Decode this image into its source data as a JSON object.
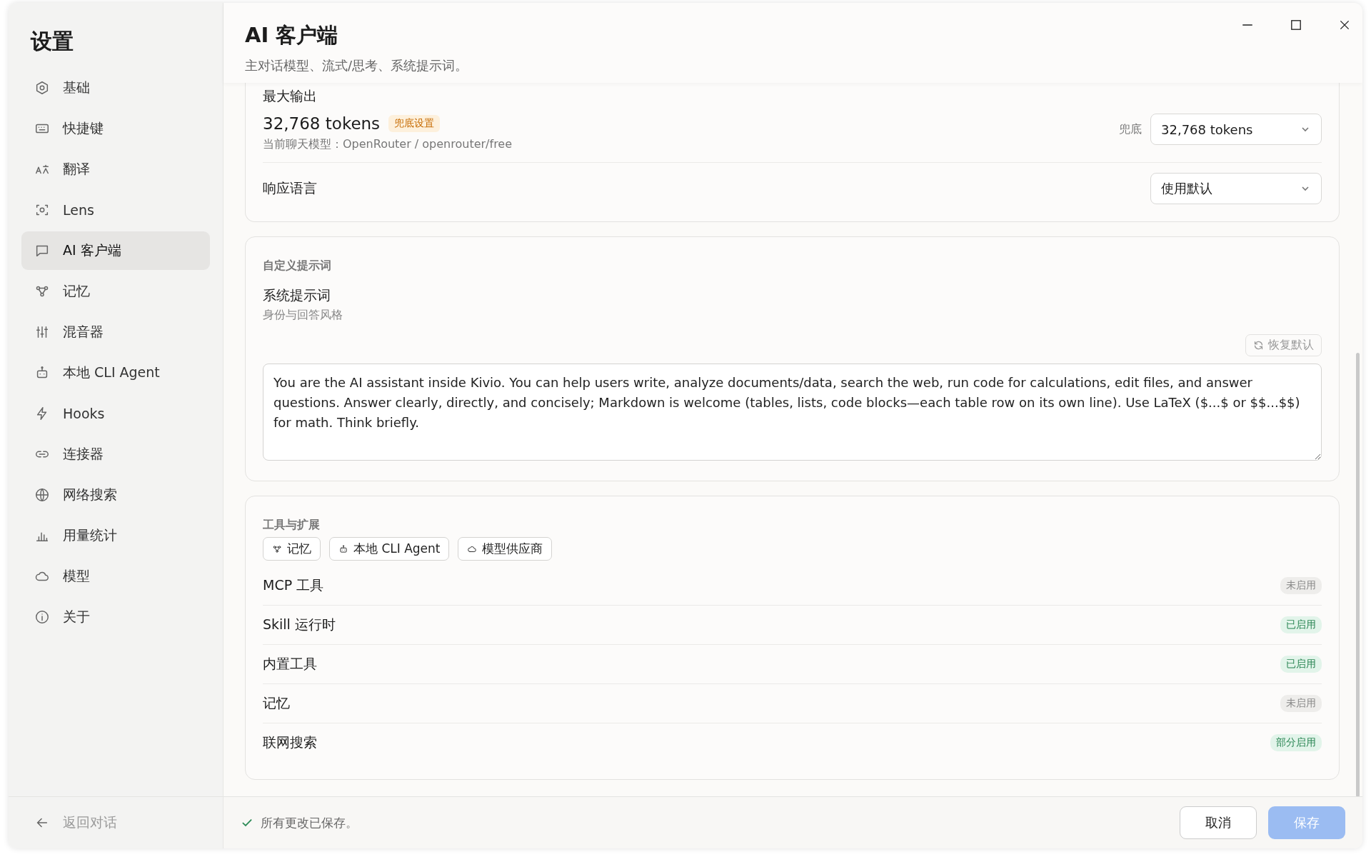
{
  "sidebar": {
    "title": "设置",
    "items": [
      {
        "label": "基础",
        "selected": false
      },
      {
        "label": "快捷键",
        "selected": false
      },
      {
        "label": "翻译",
        "selected": false
      },
      {
        "label": "Lens",
        "selected": false
      },
      {
        "label": "AI 客户端",
        "selected": true
      },
      {
        "label": "记忆",
        "selected": false
      },
      {
        "label": "混音器",
        "selected": false
      },
      {
        "label": "本地 CLI Agent",
        "selected": false
      },
      {
        "label": "Hooks",
        "selected": false
      },
      {
        "label": "连接器",
        "selected": false
      },
      {
        "label": "网络搜索",
        "selected": false
      },
      {
        "label": "用量统计",
        "selected": false
      },
      {
        "label": "模型",
        "selected": false
      },
      {
        "label": "关于",
        "selected": false
      }
    ],
    "back": "返回对话"
  },
  "header": {
    "title": "AI 客户端",
    "subtitle": "主对话模型、流式/思考、系统提示词。"
  },
  "output_card": {
    "label": "最大输出",
    "value": "32,768 tokens",
    "badge": "兜底设置",
    "model_note": "当前聊天模型：OpenRouter / openrouter/free",
    "select_label": "兜底",
    "select_value": "32,768 tokens",
    "language_label": "响应语言",
    "language_value": "使用默认"
  },
  "prompt_card": {
    "section": "自定义提示词",
    "label": "系统提示词",
    "hint": "身份与回答风格",
    "reset": "恢复默认",
    "value": "You are the AI assistant inside Kivio. You can help users write, analyze documents/data, search the web, run code for calculations, edit files, and answer questions. Answer clearly, directly, and concisely; Markdown is welcome (tables, lists, code blocks—each table row on its own line). Use LaTeX ($...$ or $$...$$) for math. Think briefly."
  },
  "tools_card": {
    "section": "工具与扩展",
    "chips": [
      "记忆",
      "本地 CLI Agent",
      "模型供应商"
    ],
    "rows": [
      {
        "label": "MCP 工具",
        "enabled": false,
        "badge": "未启用"
      },
      {
        "label": "Skill 运行时",
        "enabled": true,
        "badge": "已启用"
      },
      {
        "label": "内置工具",
        "enabled": true,
        "badge": "已启用"
      },
      {
        "label": "记忆",
        "enabled": false,
        "badge": "未启用"
      },
      {
        "label": "联网搜索",
        "enabled": true,
        "badge": "部分启用"
      }
    ]
  },
  "footer": {
    "status": "所有更改已保存。",
    "cancel": "取消",
    "save": "保存",
    "save_disabled": true
  }
}
